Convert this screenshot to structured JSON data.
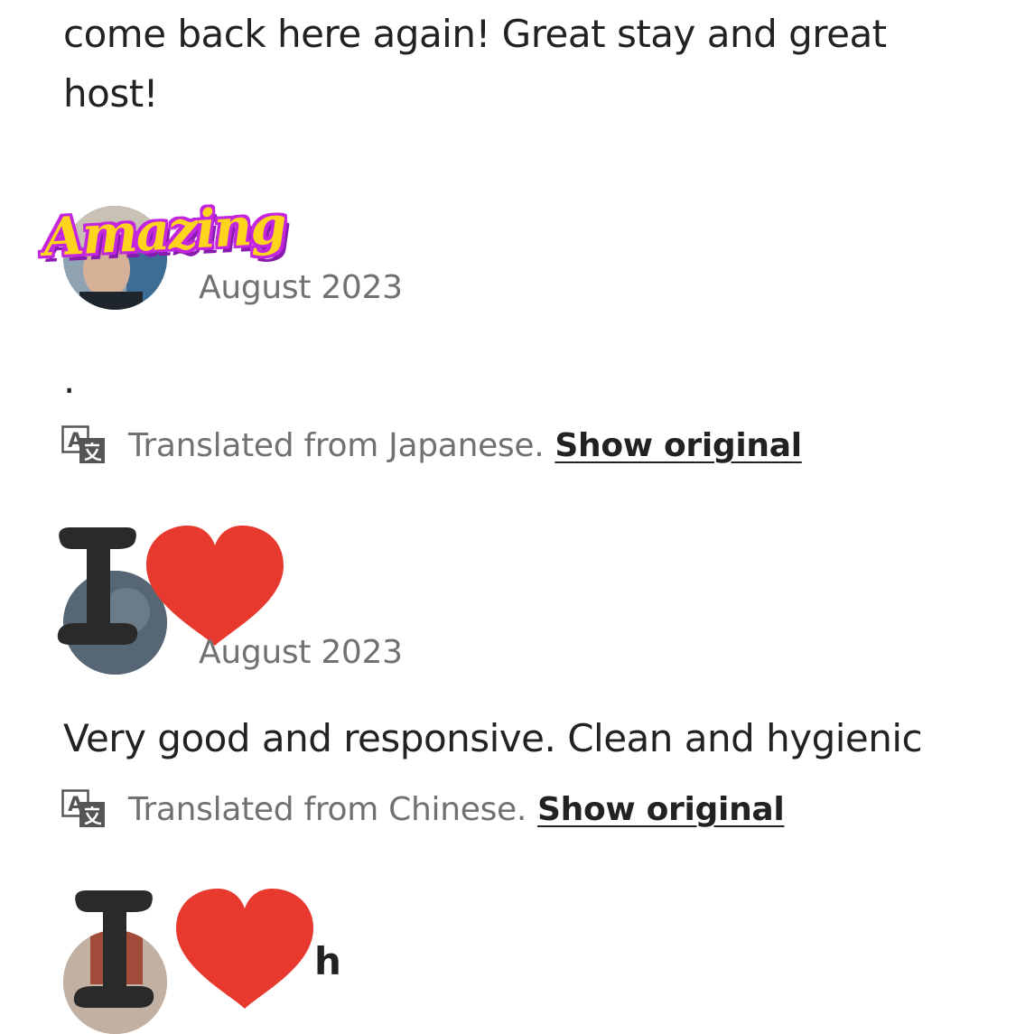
{
  "review_1": {
    "text_line_1": "come back here again! Great stay and great",
    "text_line_2": "host!"
  },
  "review_2": {
    "sticker": "Amazing",
    "date": "August 2023",
    "text": ".",
    "translation_note": "Translated from Japanese.",
    "show_original": "Show original"
  },
  "review_3": {
    "date": "August 2023",
    "text": "Very good and responsive. Clean and hygienic",
    "translation_note": "Translated from Chinese.",
    "show_original": "Show original"
  },
  "review_4": {
    "name_partial": "h"
  },
  "stickers": {
    "i_love": "I"
  },
  "icons": {
    "translate": "translate-icon",
    "heart": "heart-sticker"
  },
  "colors": {
    "text_primary": "#222222",
    "text_secondary": "#717171",
    "heart_red": "#e8392f",
    "sticker_yellow": "#ffd41c",
    "sticker_purple": "#c325e0"
  }
}
